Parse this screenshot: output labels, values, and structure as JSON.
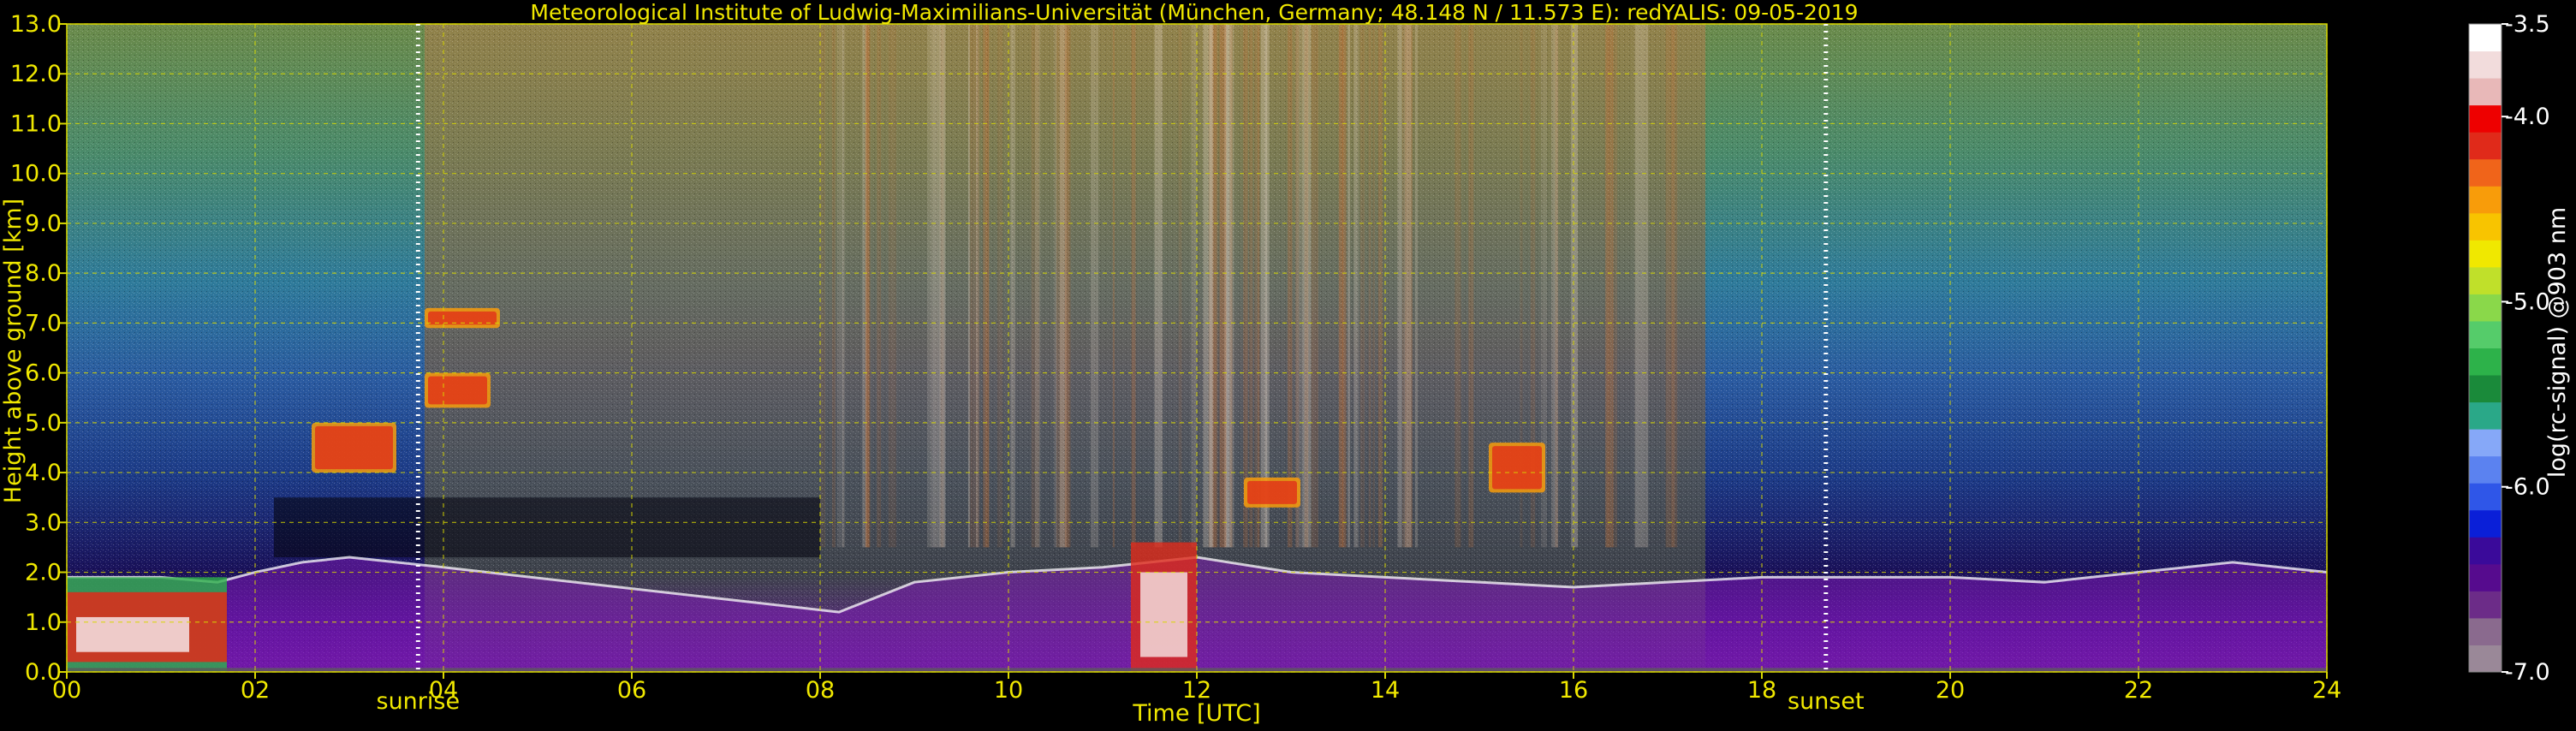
{
  "chart_data": {
    "type": "heatmap",
    "title": "Meteorological Institute of Ludwig-Maximilians-Universität (München, Germany; 48.148 N / 11.573 E):    redYALIS: 09-05-2019",
    "xlabel": "Time [UTC]",
    "ylabel": "Height above ground [km]",
    "xlim": [
      0,
      24
    ],
    "ylim": [
      0,
      13
    ],
    "x_ticks": [
      "00",
      "02",
      "04",
      "06",
      "08",
      "10",
      "12",
      "14",
      "16",
      "18",
      "20",
      "22",
      "24"
    ],
    "x_tick_values": [
      0,
      2,
      4,
      6,
      8,
      10,
      12,
      14,
      16,
      18,
      20,
      22,
      24
    ],
    "y_ticks": [
      "0.0",
      "1.0",
      "2.0",
      "3.0",
      "4.0",
      "5.0",
      "6.0",
      "7.0",
      "8.0",
      "9.0",
      "10.0",
      "11.0",
      "12.0",
      "13.0"
    ],
    "y_tick_values": [
      0,
      1,
      2,
      3,
      4,
      5,
      6,
      7,
      8,
      9,
      10,
      11,
      12,
      13
    ],
    "grid": true,
    "events": [
      {
        "label": "sunrise",
        "time": 3.73
      },
      {
        "label": "sunset",
        "time": 18.68
      }
    ],
    "colorbar": {
      "label": "log(rc-signal) @903 nm",
      "ticks": [
        "-3.5",
        "-4.0",
        "-5.0",
        "-6.0",
        "-7.0"
      ],
      "tick_values": [
        -3.5,
        -4.0,
        -5.0,
        -6.0,
        -7.0
      ],
      "range": [
        -7.0,
        -3.5
      ],
      "colors": [
        "#9a8898",
        "#8a6a8e",
        "#6c2c88",
        "#560b8e",
        "#3a0a9a",
        "#0a1fd8",
        "#2f56e8",
        "#5b82f0",
        "#86a8f8",
        "#2aa888",
        "#1a8a3a",
        "#2db24a",
        "#55cc6a",
        "#8ad84a",
        "#c0e02a",
        "#f0e800",
        "#f8c400",
        "#f89c0a",
        "#f0641a",
        "#e02a1a",
        "#ee0000",
        "#e8b8b8",
        "#f2dcdc",
        "#ffffff"
      ]
    },
    "boundary_layer_top_km": [
      {
        "t": 0,
        "h": 1.9
      },
      {
        "t": 1,
        "h": 1.9
      },
      {
        "t": 1.6,
        "h": 1.8
      },
      {
        "t": 2,
        "h": 2.0
      },
      {
        "t": 2.5,
        "h": 2.2
      },
      {
        "t": 3,
        "h": 2.3
      },
      {
        "t": 3.5,
        "h": 2.2
      },
      {
        "t": 4,
        "h": 2.1
      },
      {
        "t": 8.2,
        "h": 1.2
      },
      {
        "t": 9,
        "h": 1.8
      },
      {
        "t": 10,
        "h": 2.0
      },
      {
        "t": 11,
        "h": 2.1
      },
      {
        "t": 12,
        "h": 2.3
      },
      {
        "t": 13,
        "h": 2.0
      },
      {
        "t": 14,
        "h": 1.9
      },
      {
        "t": 15,
        "h": 1.8
      },
      {
        "t": 16,
        "h": 1.7
      },
      {
        "t": 17,
        "h": 1.8
      },
      {
        "t": 18,
        "h": 1.9
      },
      {
        "t": 19,
        "h": 1.9
      },
      {
        "t": 20,
        "h": 1.9
      },
      {
        "t": 21,
        "h": 1.8
      },
      {
        "t": 22,
        "h": 2.0
      },
      {
        "t": 23,
        "h": 2.2
      },
      {
        "t": 24,
        "h": 2.0
      }
    ],
    "aerosol_layers": [
      {
        "t0": 2.6,
        "t1": 3.5,
        "h0": 4.0,
        "h1": 5.0
      },
      {
        "t0": 3.8,
        "t1": 4.5,
        "h0": 5.3,
        "h1": 6.0
      },
      {
        "t0": 3.8,
        "t1": 4.6,
        "h0": 6.9,
        "h1": 7.3
      },
      {
        "t0": 12.5,
        "t1": 13.1,
        "h0": 3.3,
        "h1": 3.9
      },
      {
        "t0": 15.1,
        "t1": 15.7,
        "h0": 3.6,
        "h1": 4.6
      }
    ]
  }
}
